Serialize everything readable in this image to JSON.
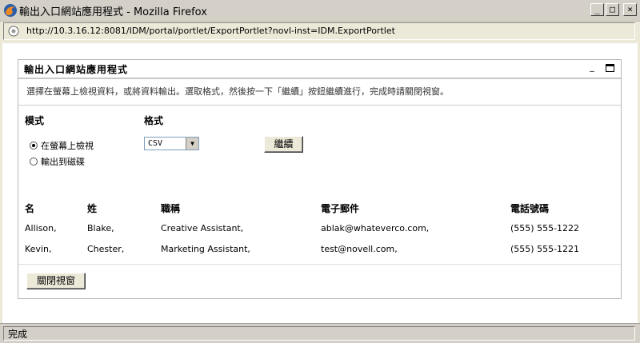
{
  "window": {
    "title": "輸出入口網站應用程式 - Mozilla Firefox",
    "url": "http://10.3.16.12:8081/IDM/portal/portlet/ExportPortlet?novl-inst=IDM.ExportPortlet",
    "status": "完成"
  },
  "icons": {
    "browser": "firefox-icon",
    "url": "page-icon",
    "minimize": "minimize-icon",
    "maximize": "maximize-icon",
    "close": "close-icon"
  },
  "portlet": {
    "title": "輸出入口網站應用程式",
    "instruction": "選擇在螢幕上檢視資料，或將資料輸出。選取格式，然後按一下「繼續」按鈕繼續進行，完成時請關閉視窗。",
    "mode_label": "模式",
    "format_label": "格式",
    "mode_options": [
      {
        "label": "在螢幕上檢視",
        "selected": true
      },
      {
        "label": "輸出到磁碟",
        "selected": false
      }
    ],
    "format_value": "CSV",
    "continue_label": "繼續",
    "close_label": "關閉視窗"
  },
  "table": {
    "headers": [
      "名",
      "姓",
      "職稱",
      "電子郵件",
      "電話號碼"
    ],
    "rows": [
      [
        "Allison,",
        "Blake,",
        "Creative Assistant,",
        "ablak@whateverco.com,",
        "(555) 555-1222"
      ],
      [
        "Kevin,",
        "Chester,",
        "Marketing Assistant,",
        "test@novell.com,",
        "(555) 555-1221"
      ]
    ]
  }
}
